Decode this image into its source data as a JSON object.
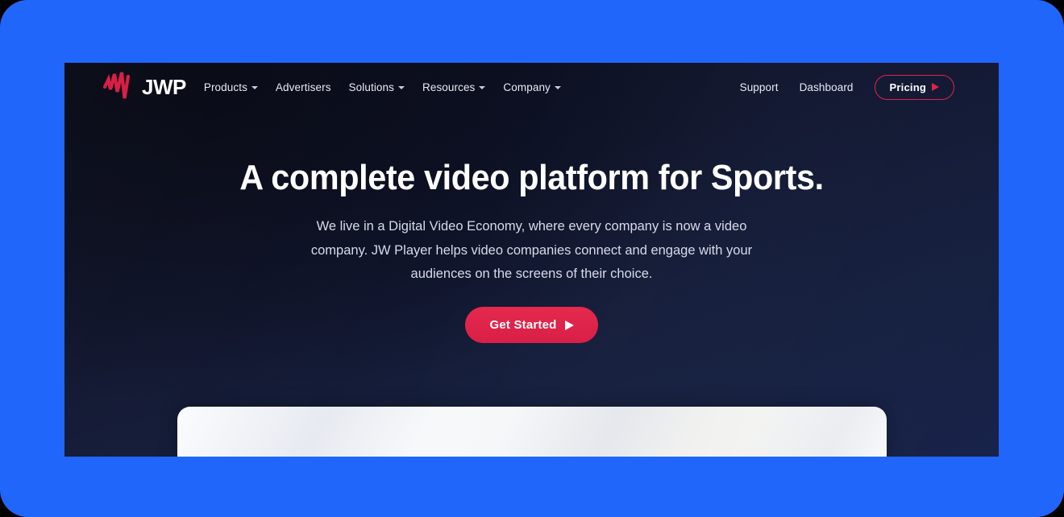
{
  "theme": {
    "frame_blue": "#2166FB",
    "panel_dark": "#121730",
    "accent_red": "#E0234A",
    "text_light": "#FFFFFF",
    "text_muted": "#D7DBE8"
  },
  "nav": {
    "logo": {
      "mark_icon": "jwp-wave-logo-icon",
      "text": "JWP"
    },
    "links": [
      {
        "label": "Products",
        "has_dropdown": true,
        "caret_icon": "chevron-down-icon"
      },
      {
        "label": "Advertisers",
        "has_dropdown": false,
        "caret_icon": ""
      },
      {
        "label": "Solutions",
        "has_dropdown": true,
        "caret_icon": "chevron-down-icon"
      },
      {
        "label": "Resources",
        "has_dropdown": true,
        "caret_icon": "chevron-down-icon"
      },
      {
        "label": "Company",
        "has_dropdown": true,
        "caret_icon": "chevron-down-icon"
      }
    ],
    "right_links": [
      {
        "label": "Support"
      },
      {
        "label": "Dashboard"
      }
    ],
    "pricing_button": {
      "label": "Pricing",
      "icon": "play-triangle-icon"
    }
  },
  "hero": {
    "title": "A complete video platform for Sports.",
    "subtitle": "We live in a Digital Video Economy, where every company is now a video company. JW Player helps video companies connect and engage with your audiences on the screens of their choice.",
    "cta": {
      "label": "Get Started",
      "icon": "play-triangle-icon"
    }
  },
  "content_card": {
    "description": "white-content-panel"
  }
}
